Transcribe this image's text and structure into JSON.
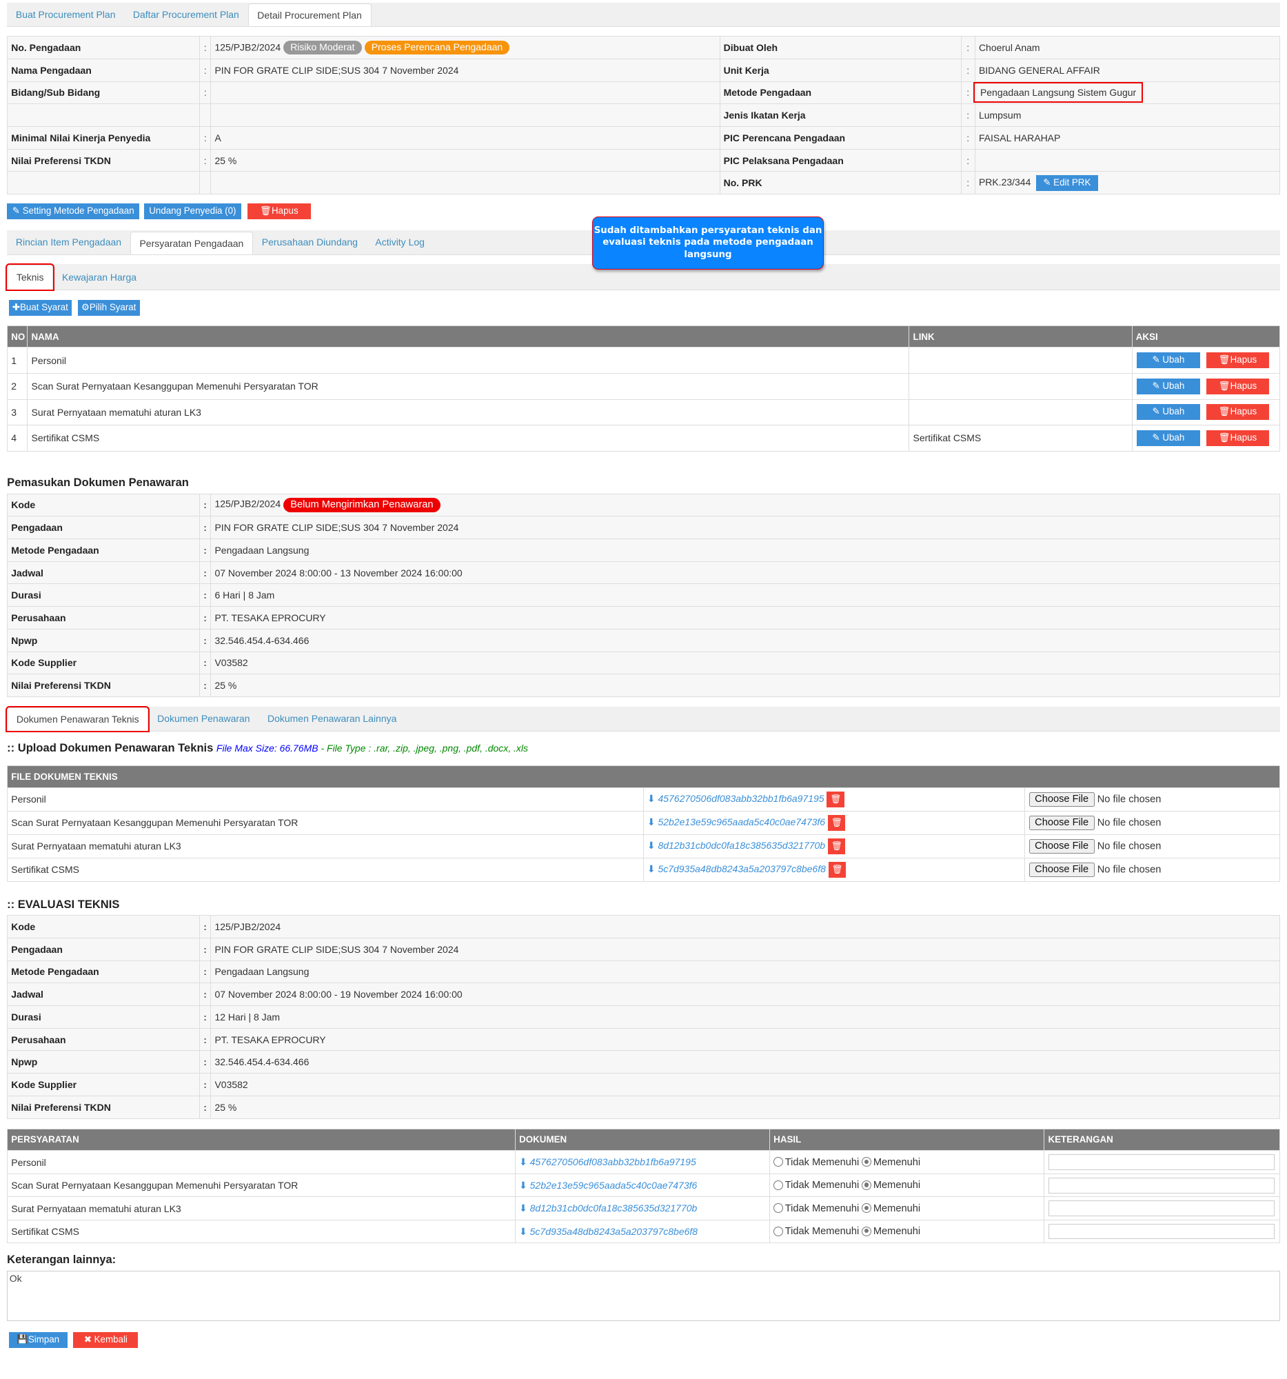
{
  "top_tabs": [
    "Buat Procurement Plan",
    "Daftar Procurement Plan",
    "Detail Procurement Plan"
  ],
  "info": {
    "left": [
      {
        "label": "No. Pengadaan",
        "value": "125/PJB2/2024"
      },
      {
        "label": "Nama Pengadaan",
        "value": "PIN FOR GRATE CLIP SIDE;SUS 304 7 November 2024"
      },
      {
        "label": "Bidang/Sub Bidang",
        "value": ""
      },
      {
        "label": "",
        "value": ""
      },
      {
        "label": "Minimal Nilai Kinerja Penyedia",
        "value": "A"
      },
      {
        "label": "Nilai Preferensi TKDN",
        "value": "25 %"
      },
      {
        "label": "",
        "value": ""
      }
    ],
    "right": [
      {
        "label": "Dibuat Oleh",
        "value": "Choerul Anam"
      },
      {
        "label": "Unit Kerja",
        "value": "BIDANG GENERAL AFFAIR"
      },
      {
        "label": "Metode Pengadaan",
        "value": "Pengadaan Langsung Sistem Gugur"
      },
      {
        "label": "Jenis Ikatan Kerja",
        "value": "Lumpsum"
      },
      {
        "label": "PIC Perencana Pengadaan",
        "value": "FAISAL HARAHAP"
      },
      {
        "label": "PIC Pelaksana Pengadaan",
        "value": ""
      },
      {
        "label": "No. PRK",
        "value": "PRK.23/344"
      }
    ],
    "badge_risk": "Risiko Moderat",
    "badge_status": "Proses Perencana Pengadaan",
    "edit_prk": "Edit PRK",
    "colors": {
      "risk": "#999999",
      "status": "#f7940c"
    }
  },
  "actions": {
    "setting": "Setting Metode Pengadaan",
    "undang": "Undang Penyedia (0)",
    "hapus": "Hapus"
  },
  "callout": "Sudah ditambahkan persyaratan teknis dan evaluasi teknis pada metode pengadaan langsung",
  "main_tabs": [
    "Rincian Item Pengadaan",
    "Persyaratan Pengadaan",
    "Perusahaan Diundang",
    "Activity Log"
  ],
  "sub_tabs": [
    "Teknis",
    "Kewajaran Harga"
  ],
  "syarat_buttons": {
    "buat": "Buat Syarat",
    "pilih": "Pilih Syarat"
  },
  "syarat_table": {
    "headers": [
      "NO",
      "NAMA",
      "LINK",
      "AKSI"
    ],
    "ubah": "Ubah",
    "hapus": "Hapus",
    "rows": [
      {
        "no": "1",
        "nama": "Personil",
        "link": ""
      },
      {
        "no": "2",
        "nama": "Scan Surat Pernyataan Kesanggupan Memenuhi Persyaratan TOR",
        "link": ""
      },
      {
        "no": "3",
        "nama": "Surat Pernyataan mematuhi aturan LK3",
        "link": ""
      },
      {
        "no": "4",
        "nama": "Sertifikat CSMS",
        "link": "Sertifikat CSMS"
      }
    ]
  },
  "pemasukan": {
    "title": "Pemasukan Dokumen Penawaran",
    "badge": "Belum Mengirimkan Penawaran",
    "rows": [
      {
        "label": "Kode",
        "value": "125/PJB2/2024"
      },
      {
        "label": "Pengadaan",
        "value": "PIN FOR GRATE CLIP SIDE;SUS 304 7 November 2024"
      },
      {
        "label": "Metode Pengadaan",
        "value": "Pengadaan Langsung"
      },
      {
        "label": "Jadwal",
        "value": "07 November 2024 8:00:00 - 13 November 2024 16:00:00"
      },
      {
        "label": "Durasi",
        "value": "6 Hari | 8 Jam"
      },
      {
        "label": "Perusahaan",
        "value": "PT. TESAKA EPROCURY"
      },
      {
        "label": "Npwp",
        "value": "32.546.454.4-634.466"
      },
      {
        "label": "Kode Supplier",
        "value": "V03582"
      },
      {
        "label": "Nilai Preferensi TKDN",
        "value": "25 %"
      }
    ]
  },
  "doc_tabs": [
    "Dokumen Penawaran Teknis",
    "Dokumen Penawaran",
    "Dokumen Penawaran Lainnya"
  ],
  "upload": {
    "title": ":: Upload Dokumen Penawaran Teknis",
    "max": "File Max Size: 66.76MB",
    "type": " - File Type : .rar, .zip, .jpeg, .png, .pdf, .docx, .xls",
    "header": "FILE DOKUMEN TEKNIS",
    "choose": "Choose File",
    "nofile": "No file chosen",
    "rows": [
      {
        "nama": "Personil",
        "file": "4576270506df083abb32bb1fb6a97195"
      },
      {
        "nama": "Scan Surat Pernyataan Kesanggupan Memenuhi Persyaratan TOR",
        "file": "52b2e13e59c965aada5c40c0ae7473f6"
      },
      {
        "nama": "Surat Pernyataan mematuhi aturan LK3",
        "file": "8d12b31cb0dc0fa18c385635d321770b"
      },
      {
        "nama": "Sertifikat CSMS",
        "file": "5c7d935a48db8243a5a203797c8be6f8"
      }
    ]
  },
  "evaluasi": {
    "title": ":: EVALUASI TEKNIS",
    "rows": [
      {
        "label": "Kode",
        "value": "125/PJB2/2024"
      },
      {
        "label": "Pengadaan",
        "value": "PIN FOR GRATE CLIP SIDE;SUS 304 7 November 2024"
      },
      {
        "label": "Metode Pengadaan",
        "value": "Pengadaan Langsung"
      },
      {
        "label": "Jadwal",
        "value": "07 November 2024 8:00:00 - 19 November 2024 16:00:00"
      },
      {
        "label": "Durasi",
        "value": "12 Hari | 8 Jam"
      },
      {
        "label": "Perusahaan",
        "value": "PT. TESAKA EPROCURY"
      },
      {
        "label": "Npwp",
        "value": "32.546.454.4-634.466"
      },
      {
        "label": "Kode Supplier",
        "value": "V03582"
      },
      {
        "label": "Nilai Preferensi TKDN",
        "value": "25 %"
      }
    ],
    "headers": [
      "PERSYARATAN",
      "DOKUMEN",
      "HASIL",
      "KETERANGAN"
    ],
    "opt_no": "Tidak Memenuhi",
    "opt_yes": "Memenuhi",
    "rows2": [
      {
        "nama": "Personil",
        "file": "4576270506df083abb32bb1fb6a97195",
        "hasil": "Memenuhi"
      },
      {
        "nama": "Scan Surat Pernyataan Kesanggupan Memenuhi Persyaratan TOR",
        "file": "52b2e13e59c965aada5c40c0ae7473f6",
        "hasil": "Memenuhi"
      },
      {
        "nama": "Surat Pernyataan mematuhi aturan LK3",
        "file": "8d12b31cb0dc0fa18c385635d321770b",
        "hasil": "Memenuhi"
      },
      {
        "nama": "Sertifikat CSMS",
        "file": "5c7d935a48db8243a5a203797c8be6f8",
        "hasil": "Memenuhi"
      }
    ],
    "keterangan_label": "Keterangan lainnya:",
    "keterangan_value": "Ok"
  },
  "footer": {
    "simpan": "Simpan",
    "kembali": "Kembali"
  }
}
